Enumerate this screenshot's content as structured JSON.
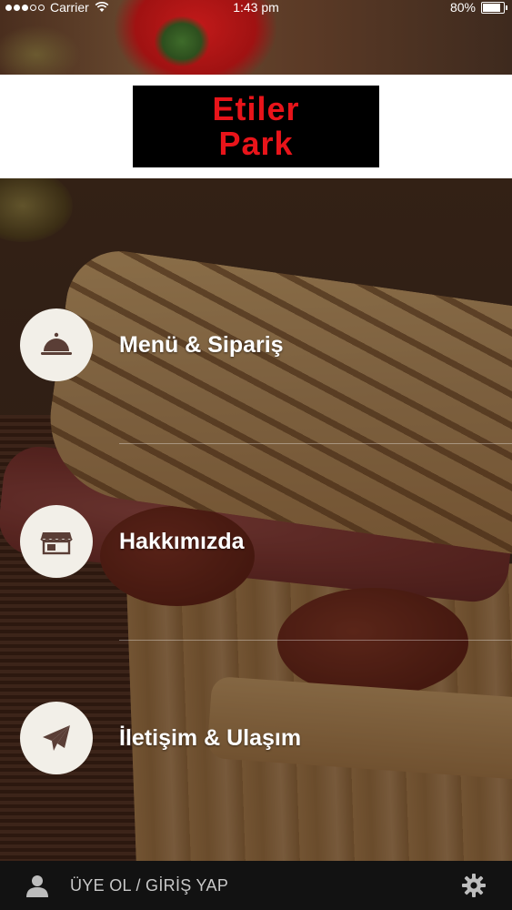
{
  "status_bar": {
    "carrier": "Carrier",
    "time": "1:43 pm",
    "battery": "80%",
    "battery_level": 0.8,
    "signal_icon": "signal-dots-icon",
    "wifi_icon": "wifi-icon"
  },
  "header": {
    "logo_line1": "Etiler",
    "logo_line2": "Park",
    "logo_color": "#e8141a"
  },
  "menu": {
    "items": [
      {
        "label": "Menü & Sipariş",
        "icon": "cloche-icon"
      },
      {
        "label": "Hakkımızda",
        "icon": "storefront-icon"
      },
      {
        "label": "İletişim & Ulaşım",
        "icon": "paper-plane-icon"
      }
    ]
  },
  "bottom_bar": {
    "login_label": "ÜYE OL / GİRİŞ YAP",
    "user_icon": "user-icon",
    "settings_icon": "gear-icon"
  }
}
